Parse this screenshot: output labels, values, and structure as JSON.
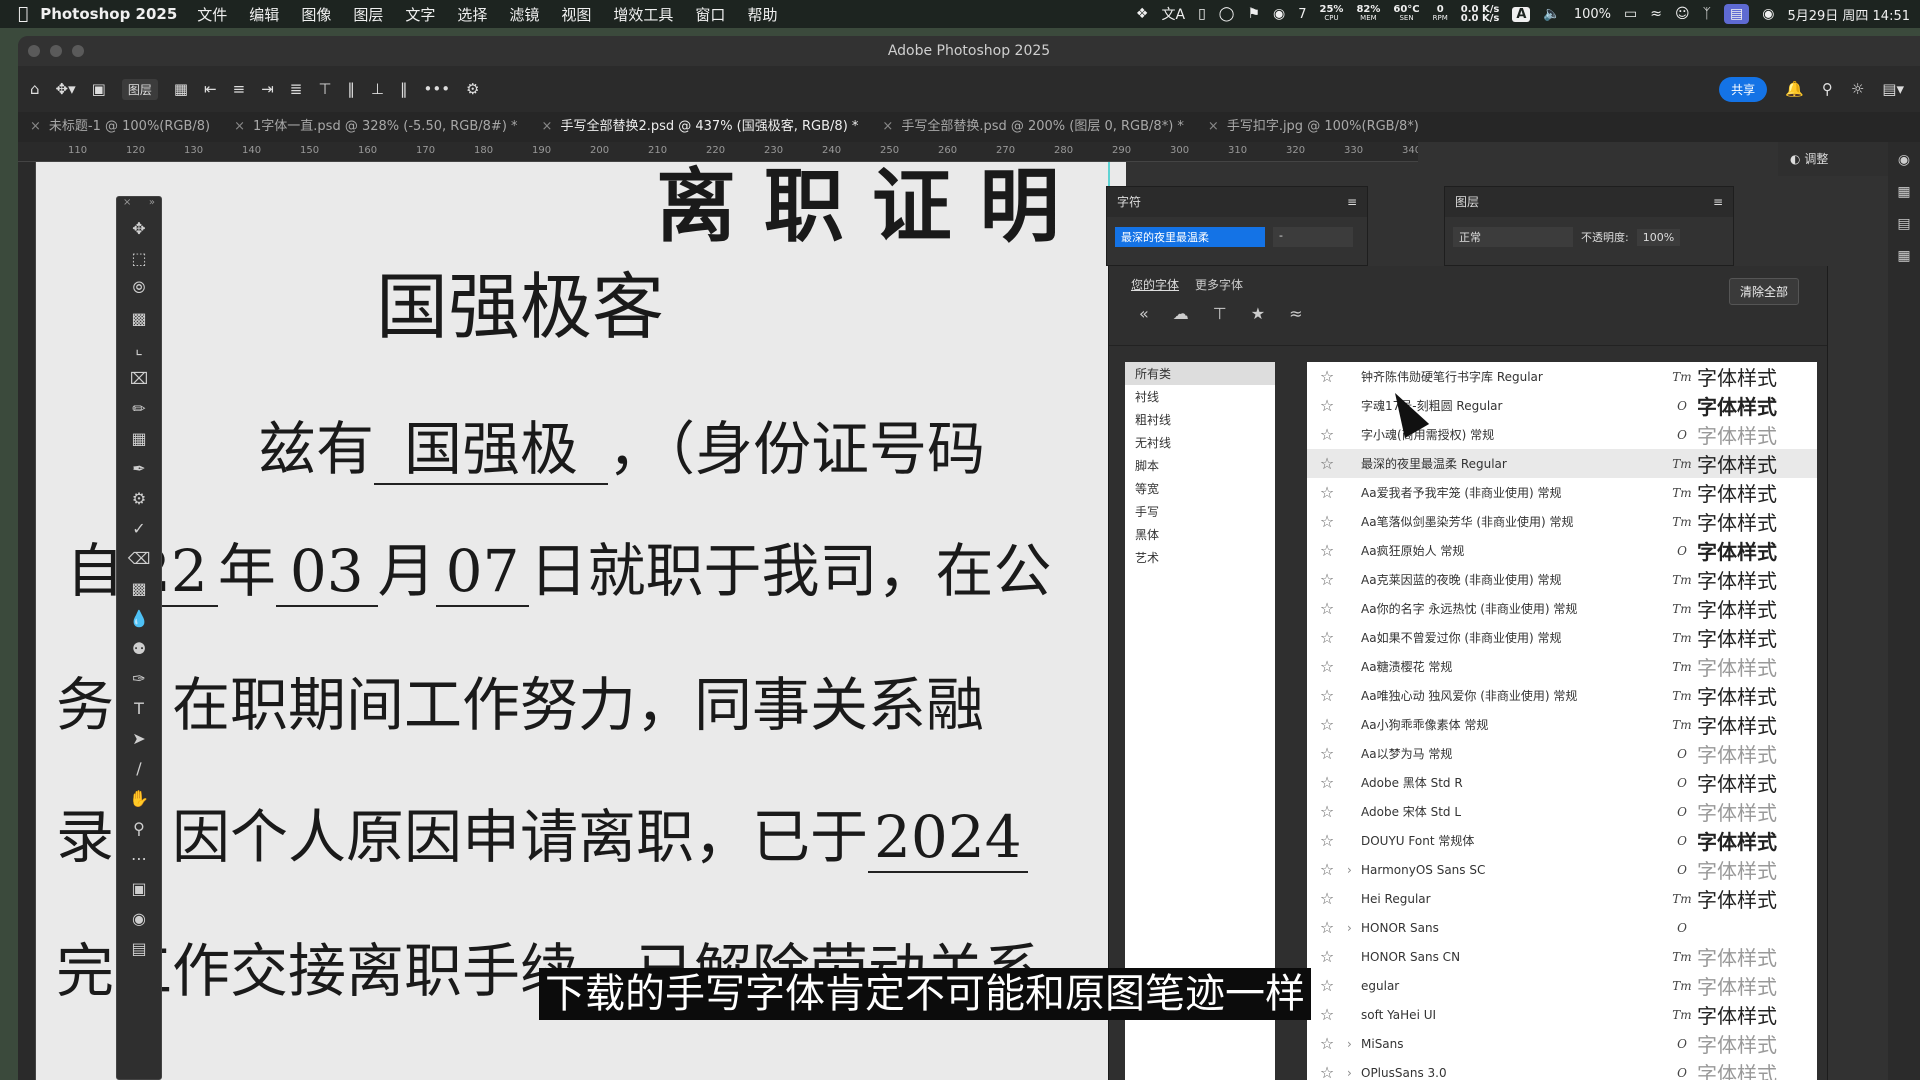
{
  "menubar": {
    "app": "Photoshop 2025",
    "items": [
      "文件",
      "编辑",
      "图像",
      "图层",
      "文字",
      "选择",
      "滤镜",
      "视图",
      "增效工具",
      "窗口",
      "帮助"
    ],
    "wechat_count": "7",
    "cpu": "25%",
    "cpu_l": "CPU",
    "mem": "82%",
    "mem_l": "MEM",
    "sen": "60°C",
    "sen_l": "SEN",
    "rpm": "0",
    "rpm_l": "RPM",
    "net": "0.0 K/s",
    "ime": "A",
    "battery": "100%",
    "datetime": "5月29日 周四  14:51"
  },
  "window": {
    "title": "Adobe Photoshop 2025"
  },
  "options": {
    "layer_select": "图层",
    "share": "共享"
  },
  "tabs": [
    {
      "label": "未标题-1 @ 100%(RGB/8)"
    },
    {
      "label": "1字体一直.psd @ 328% (-5.50, RGB/8#) *"
    },
    {
      "label": "手写全部替换2.psd @ 437% (国强极客, RGB/8) *"
    },
    {
      "label": "手写全部替换.psd @ 200% (图层 0, RGB/8*) *"
    },
    {
      "label": "手写扣字.jpg @ 100%(RGB/8*)"
    }
  ],
  "ruler": [
    "110",
    "120",
    "130",
    "140",
    "150",
    "160",
    "170",
    "180",
    "190",
    "200",
    "210",
    "220",
    "230",
    "240",
    "250",
    "260",
    "270",
    "280",
    "290",
    "300",
    "310",
    "320",
    "330",
    "340"
  ],
  "document": {
    "heading": "离 职 证 明",
    "name_hand": "国强极客",
    "line1a": "兹有",
    "line1_name": "国强极",
    "line1b": "，（身份证号码",
    "line2a": "自",
    "line2_year": "22",
    "line2b": "年",
    "line2_month": "03",
    "line2c": "月",
    "line2_day": "07",
    "line2d": "日就职于我司，在公",
    "line3": "务，在职期间工作努力，同事关系融",
    "line4a": "录，因个人原因申请离职，已于",
    "line4_year": "2024",
    "line5": "完工作交接离职手续，已解除劳动关系"
  },
  "char_panel": {
    "title": "字符",
    "font": "最深的夜里最温柔"
  },
  "layers_panel": {
    "title": "图层",
    "blend": "正常",
    "opacity_label": "不透明度:",
    "opacity": "100%"
  },
  "adjust_tab": "调整",
  "font_popup": {
    "your_fonts": "您的字体",
    "more_fonts": "更多字体",
    "clear_all": "清除全部",
    "categories": [
      "所有类",
      "衬线",
      "粗衬线",
      "无衬线",
      "脚本",
      "等宽",
      "手写",
      "黑体",
      "艺术"
    ],
    "fonts": [
      {
        "name": "钟齐陈伟勋硬笔行书字库 Regular",
        "type": "Tт",
        "preview": "字体样式",
        "style": "hand",
        "chev": false
      },
      {
        "name": "字魂17号-刻粗圆 Regular",
        "type": "O",
        "preview": "字体样式",
        "style": "bold",
        "chev": false
      },
      {
        "name": "字小魂(商用需授权) 常规",
        "type": "O",
        "preview": "字体样式",
        "style": "light",
        "chev": false
      },
      {
        "name": "最深的夜里最温柔 Regular",
        "type": "Tт",
        "preview": "字体样式",
        "style": "hand",
        "chev": false,
        "selected": true
      },
      {
        "name": "Aa爱我者予我牢笼 (非商业使用) 常规",
        "type": "Tт",
        "preview": "字体样式",
        "style": "hand",
        "chev": false
      },
      {
        "name": "Aa笔落似剑墨染芳华 (非商业使用) 常规",
        "type": "Tт",
        "preview": "字体样式",
        "style": "hand",
        "chev": false
      },
      {
        "name": "Aa疯狂原始人 常规",
        "type": "O",
        "preview": "字体样式",
        "style": "bold",
        "chev": false
      },
      {
        "name": "Aa克莱因蓝的夜晚 (非商业使用) 常规",
        "type": "Tт",
        "preview": "字体样式",
        "style": "hand",
        "chev": false
      },
      {
        "name": "Aa你的名字 永远热忱 (非商业使用) 常规",
        "type": "Tт",
        "preview": "字体样式",
        "style": "hand",
        "chev": false
      },
      {
        "name": "Aa如果不曾爱过你 (非商业使用) 常规",
        "type": "Tт",
        "preview": "字体样式",
        "style": "hand",
        "chev": false
      },
      {
        "name": "Aa糖渍樱花 常规",
        "type": "Tт",
        "preview": "字体样式",
        "style": "light",
        "chev": false
      },
      {
        "name": "Aa唯独心动 独风爱你 (非商业使用) 常规",
        "type": "Tт",
        "preview": "字体样式",
        "style": "hand",
        "chev": false
      },
      {
        "name": "Aa小狗乖乖像素体 常规",
        "type": "Tт",
        "preview": "字体样式",
        "style": "normal",
        "chev": false
      },
      {
        "name": "Aa以梦为马 常规",
        "type": "O",
        "preview": "字体样式",
        "style": "light",
        "chev": false
      },
      {
        "name": "Adobe 黑体 Std R",
        "type": "O",
        "preview": "字体样式",
        "style": "normal",
        "chev": false
      },
      {
        "name": "Adobe 宋体 Std L",
        "type": "O",
        "preview": "字体样式",
        "style": "light",
        "chev": false
      },
      {
        "name": "DOUYU Font 常规体",
        "type": "O",
        "preview": "字体样式",
        "style": "bold",
        "chev": false
      },
      {
        "name": "HarmonyOS Sans SC",
        "type": "O",
        "preview": "字体样式",
        "style": "light",
        "chev": true
      },
      {
        "name": "Hei Regular",
        "type": "Tт",
        "preview": "字体样式",
        "style": "normal",
        "chev": false
      },
      {
        "name": "HONOR Sans",
        "type": "O",
        "preview": "",
        "style": "normal",
        "chev": true
      },
      {
        "name": "HONOR Sans CN",
        "type": "Tт",
        "preview": "字体样式",
        "style": "light",
        "chev": false
      },
      {
        "name": "egular",
        "type": "Tт",
        "preview": "字体样式",
        "style": "light",
        "chev": false
      },
      {
        "name": "soft YaHei UI",
        "type": "Tт",
        "preview": "字体样式",
        "style": "normal",
        "chev": false
      },
      {
        "name": "MiSans",
        "type": "O",
        "preview": "字体样式",
        "style": "light",
        "chev": true
      },
      {
        "name": "OPlusSans 3.0",
        "type": "O",
        "preview": "字体样式",
        "style": "light",
        "chev": true
      }
    ]
  },
  "subtitle": "下载的手写字体肯定不可能和原图笔迹一样",
  "colors": {
    "accent": "#1473e6",
    "guide": "#5fd3d3"
  }
}
